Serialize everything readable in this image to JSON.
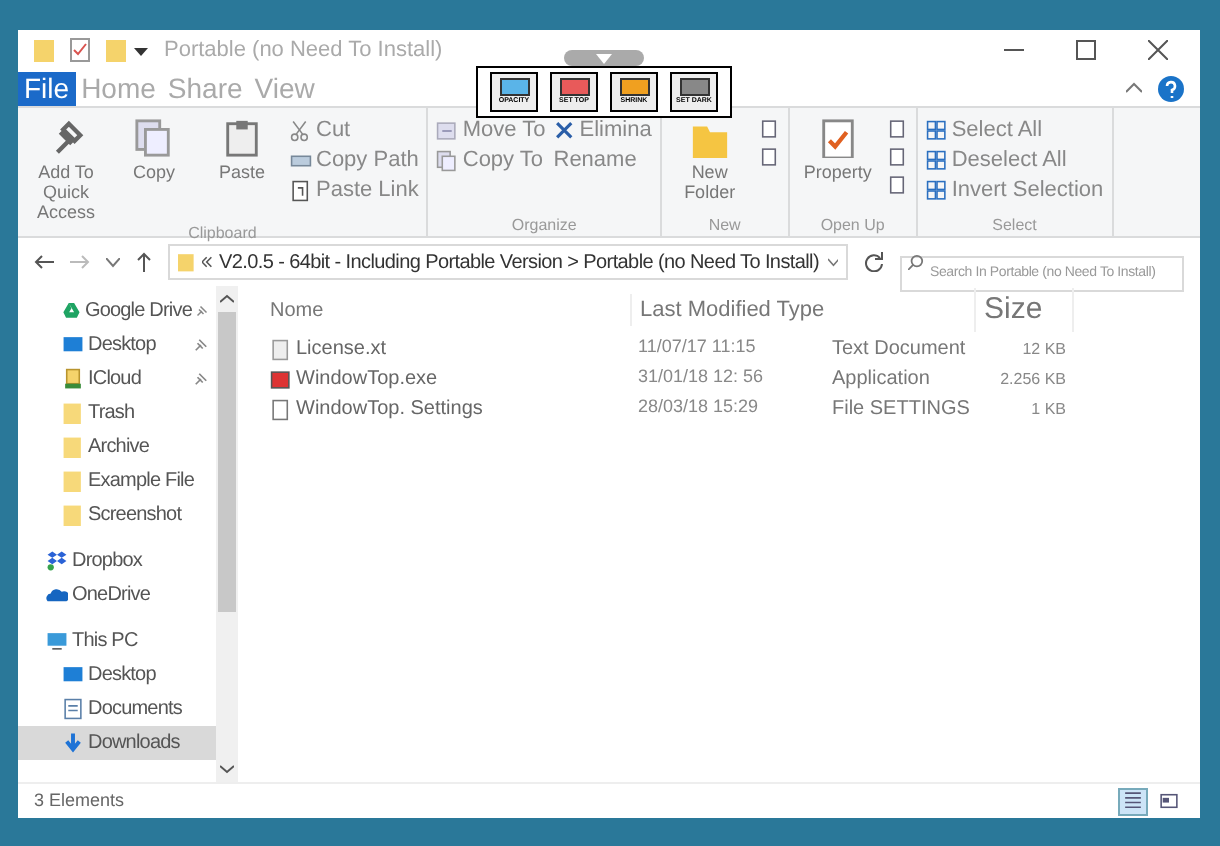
{
  "window": {
    "title": "Portable (no Need To Install)"
  },
  "overlay_toolbar": {
    "buttons": [
      {
        "label": "OPACITY",
        "color": "#5ab4e8"
      },
      {
        "label": "SET TOP",
        "color": "#e85a5a"
      },
      {
        "label": "SHRINK",
        "color": "#f0a020"
      },
      {
        "label": "SET DARK",
        "color": "#888888"
      }
    ]
  },
  "menu_tabs": [
    {
      "label": "File",
      "selected": true
    },
    {
      "label": "Home",
      "selected": false
    },
    {
      "label": "Share",
      "selected": false
    },
    {
      "label": "View",
      "selected": false
    }
  ],
  "ribbon": {
    "groups": [
      {
        "label": "Clipboard",
        "buttons": [
          {
            "kind": "large",
            "label": "Add To Quick Access"
          },
          {
            "kind": "large",
            "label": "Copy"
          },
          {
            "kind": "large",
            "label": "Paste"
          },
          {
            "kind": "stack",
            "items": [
              {
                "label": "Cut"
              },
              {
                "label": "Copy Path"
              },
              {
                "label": "Paste Link"
              }
            ]
          }
        ]
      },
      {
        "label": "Organize",
        "buttons": [
          {
            "kind": "stack",
            "items": [
              {
                "label": "Move To"
              },
              {
                "label": "Copy To"
              }
            ]
          },
          {
            "kind": "stack",
            "items": [
              {
                "label": "Elimina"
              },
              {
                "label": "Rename"
              }
            ]
          }
        ]
      },
      {
        "label": "New",
        "buttons": [
          {
            "kind": "large",
            "label": "New Folder"
          }
        ]
      },
      {
        "label": "Open Up",
        "buttons": [
          {
            "kind": "large",
            "label": "Property"
          }
        ]
      },
      {
        "label": "Select",
        "buttons": [
          {
            "kind": "stack",
            "items": [
              {
                "label": "Select All"
              },
              {
                "label": "Deselect All"
              },
              {
                "label": "Invert Selection"
              }
            ]
          }
        ]
      }
    ]
  },
  "address_bar": {
    "path": "V2.0.5 - 64bit - Including Portable Version > Portable (no Need To Install)",
    "search_placeholder": "Search In Portable (no Need To Install)"
  },
  "sidebar": {
    "items": [
      {
        "label": "Google Drive",
        "pinned": true,
        "selected": false
      },
      {
        "label": "Desktop",
        "pinned": true,
        "selected": false
      },
      {
        "label": "ICloud",
        "pinned": true,
        "selected": false
      },
      {
        "label": "Trash",
        "pinned": false,
        "selected": false
      },
      {
        "label": "Archive",
        "pinned": false,
        "selected": false
      },
      {
        "label": "Example File",
        "pinned": false,
        "selected": false
      },
      {
        "label": "Screenshot",
        "pinned": false,
        "selected": false
      },
      {
        "label": "Dropbox",
        "pinned": false,
        "selected": false
      },
      {
        "label": "OneDrive",
        "pinned": false,
        "selected": false
      },
      {
        "label": "This PC",
        "pinned": false,
        "selected": false
      },
      {
        "label": "Desktop",
        "pinned": false,
        "selected": false
      },
      {
        "label": "Documents",
        "pinned": false,
        "selected": false
      },
      {
        "label": "Downloads",
        "pinned": false,
        "selected": true
      }
    ]
  },
  "table": {
    "columns": [
      "Nome",
      "Last Modified Type",
      "Size"
    ],
    "rows": [
      {
        "name": "License.xt",
        "modified": "11/07/17 11:15",
        "type": "Text Document",
        "size": "12 KB"
      },
      {
        "name": "WindowTop.exe",
        "modified": "31/01/18 12: 56",
        "type": "Application",
        "size": "2.256 KB"
      },
      {
        "name": "WindowTop. Settings",
        "modified": "28/03/18 15:29",
        "type": "File SETTINGS",
        "size": "1 KB"
      }
    ]
  },
  "status_bar": {
    "text": "3 Elements",
    "views": [
      {
        "kind": "details",
        "selected": true
      },
      {
        "kind": "tiles",
        "selected": false
      }
    ]
  }
}
